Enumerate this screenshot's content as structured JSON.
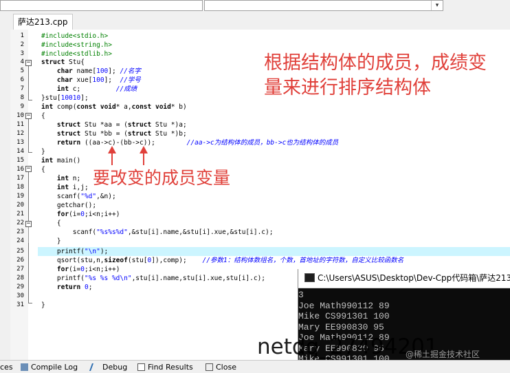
{
  "toolbar": {
    "right_combo_text": "",
    "dropdown_arrow": "▾"
  },
  "file_tab": {
    "label": "萨达213.cpp"
  },
  "editor": {
    "line_numbers": [
      "1",
      "2",
      "3",
      "4",
      "5",
      "6",
      "7",
      "8",
      "9",
      "10",
      "11",
      "12",
      "13",
      "14",
      "15",
      "16",
      "17",
      "18",
      "19",
      "20",
      "21",
      "22",
      "23",
      "24",
      "25",
      "26",
      "27",
      "28",
      "29",
      "30",
      "31"
    ],
    "fold_minus": "−"
  },
  "annotations": {
    "top_line1": "根据结构体的成员，成绩变",
    "top_line2": "量来进行排序结构体",
    "middle": "要改变的成员变量"
  },
  "console": {
    "title": "C:\\Users\\ASUS\\Desktop\\Dev-Cpp代码箱\\萨达213",
    "output": "3\nJoe Math990112 89\nMike CS991301 100\nMary EE990830 95\nJoe Math990112 89\nMary EE990830 95\nMike CS991301 100"
  },
  "bottom_tabs": {
    "ces": "ces",
    "compile_log": "Compile Log",
    "debug": "Debug",
    "find_results": "Find Results",
    "close": "Close"
  },
  "watermark": {
    "main": "netdq_27494201",
    "small": "@稀土掘金技术社区"
  },
  "colors": {
    "annotation_red": "#e0403a",
    "highlight_line": "#ccf5ff",
    "preprocessor_green": "#008000",
    "comment_blue": "#0000ff"
  }
}
